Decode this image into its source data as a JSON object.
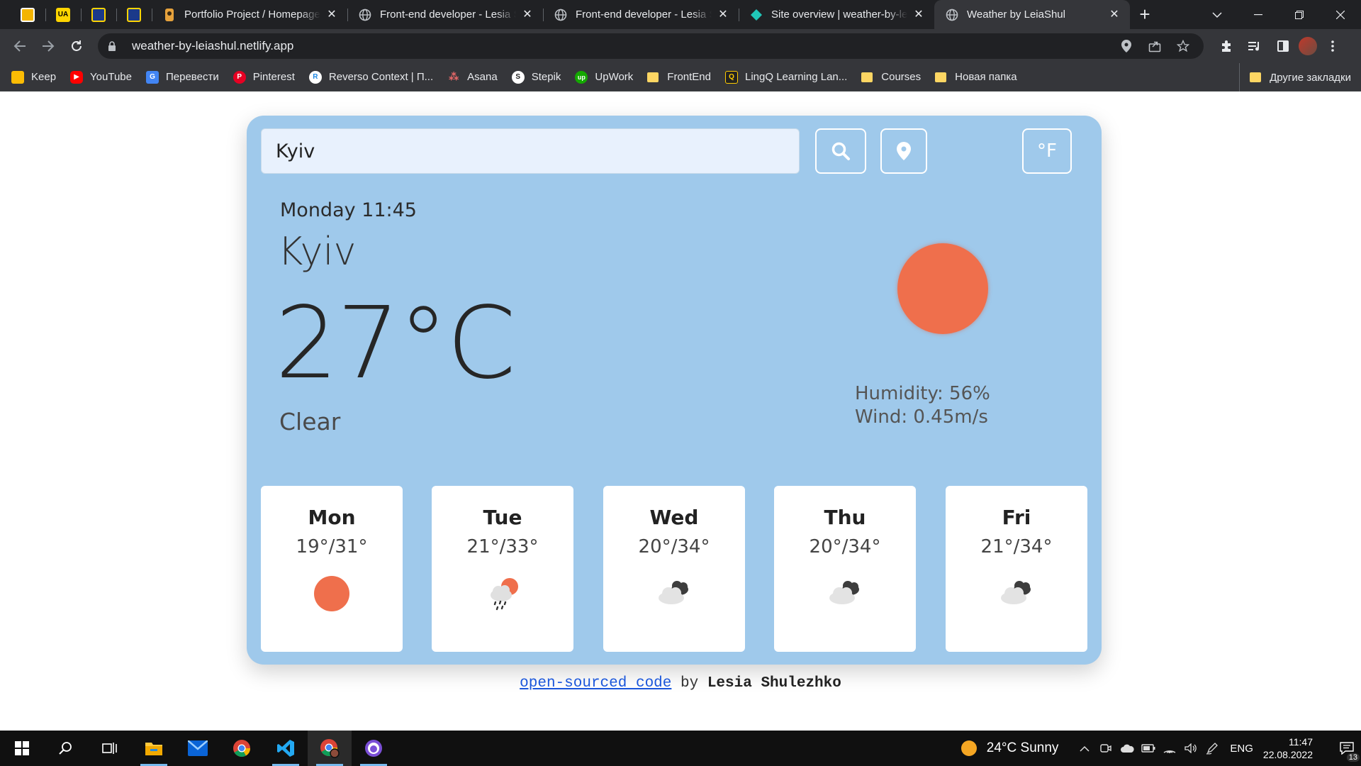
{
  "browser": {
    "tabs": [
      {
        "title": "Portfolio Project / Homepage"
      },
      {
        "title": "Front-end developer - Lesia Shulezhko"
      },
      {
        "title": "Front-end developer - Lesia Shulezhko"
      },
      {
        "title": "Site overview | weather-by-leiashul"
      },
      {
        "title": "Weather by LeiaShul",
        "active": true
      }
    ],
    "address": "weather-by-leiashul.netlify.app",
    "bookmarks": [
      {
        "label": "Keep",
        "color": "#fbbc04"
      },
      {
        "label": "YouTube",
        "color": "#ff0000"
      },
      {
        "label": "Перевести",
        "color": "#4285f4"
      },
      {
        "label": "Pinterest",
        "color": "#e60023"
      },
      {
        "label": "Reverso Context | П...",
        "color": "#1e88e5"
      },
      {
        "label": "Asana",
        "color": "#f06a6a"
      },
      {
        "label": "Stepik",
        "color": "#222222"
      },
      {
        "label": "UpWork",
        "color": "#14a800"
      },
      {
        "label": "FrontEnd",
        "folder": true
      },
      {
        "label": "LingQ Learning Lan...",
        "color": "#ffcc00"
      },
      {
        "label": "Courses",
        "folder": true
      },
      {
        "label": "Новая папка",
        "folder": true
      }
    ],
    "other_bookmarks": "Другие закладки"
  },
  "app": {
    "search_value": "Kyiv",
    "unit_button": "°F",
    "datetime": "Monday 11:45",
    "city": "Kyiv",
    "temperature": "27°C",
    "description": "Clear",
    "humidity": "Humidity: 56%",
    "wind": "Wind: 0.45m/s",
    "accent_color": "#9fc9eb",
    "sun_color": "#ef6f4c",
    "forecast": [
      {
        "day": "Mon",
        "range": "19°/31°",
        "icon": "sun-icon"
      },
      {
        "day": "Tue",
        "range": "21°/33°",
        "icon": "rain-sun-icon"
      },
      {
        "day": "Wed",
        "range": "20°/34°",
        "icon": "clouds-icon"
      },
      {
        "day": "Thu",
        "range": "20°/34°",
        "icon": "clouds-icon"
      },
      {
        "day": "Fri",
        "range": "21°/34°",
        "icon": "clouds-icon"
      }
    ],
    "footer": {
      "link": "open-sourced code",
      "by": "by",
      "author": "Lesia Shulezhko"
    }
  },
  "taskbar": {
    "weather": "24°C  Sunny",
    "lang": "ENG",
    "time": "11:47",
    "date": "22.08.2022",
    "notifications": "13"
  }
}
